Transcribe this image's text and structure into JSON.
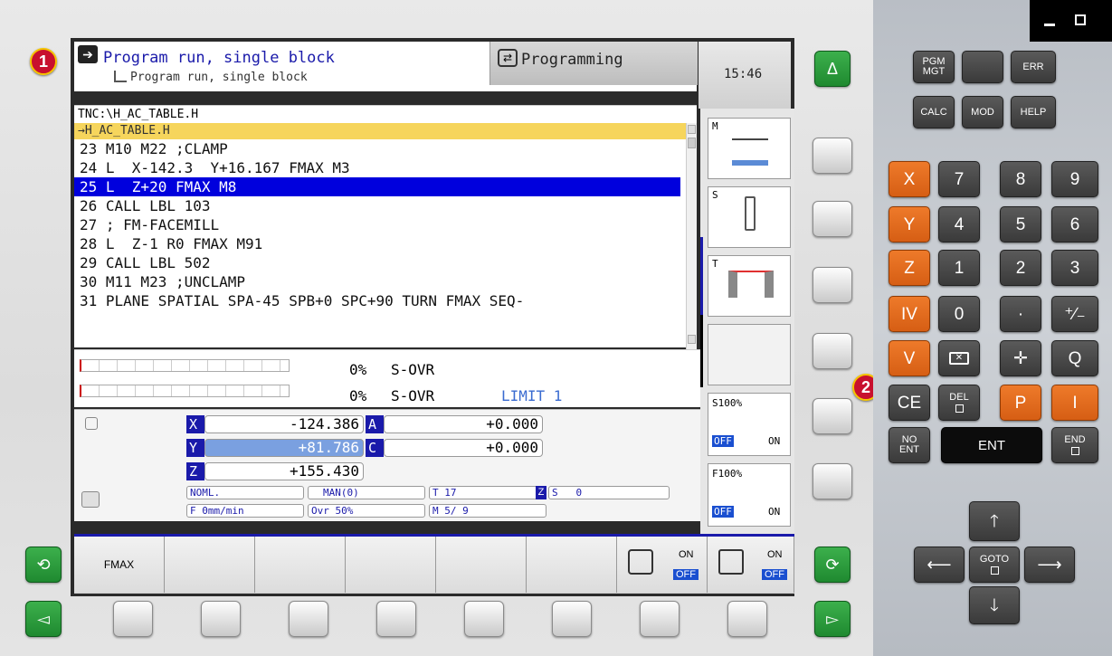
{
  "screen": {
    "mode_active": "Program run, single block",
    "mode_sub": "Program run, single block",
    "mode_other": "Programming",
    "clock": "15:46",
    "path": "TNC:\\H_AC_TABLE.H",
    "file_label": "→H_AC_TABLE.H",
    "program_lines": [
      "23 M10 M22 ;CLAMP",
      "24 L  X-142.3  Y+16.167 FMAX M3",
      "25 L  Z+20 FMAX M8",
      "26 CALL LBL 103",
      "27 ; FM-FACEMILL",
      "28 L  Z-1 R0 FMAX M91",
      "29 CALL LBL 502",
      "30 M11 M23 ;UNCLAMP",
      "31 PLANE SPATIAL SPA-45 SPB+0 SPC+90 TURN FMAX SEQ-"
    ],
    "selected_line_index": 2,
    "override_rows": [
      {
        "pct": "0%",
        "label": "S-OVR",
        "extra": ""
      },
      {
        "pct": "0%",
        "label": "S-OVR",
        "extra": "LIMIT 1"
      }
    ],
    "positions": {
      "X": "-124.386",
      "Y": "+81.786",
      "Z": "+155.430",
      "A": "+0.000",
      "C": "+0.000"
    },
    "status": {
      "noml": "NOML.",
      "man": "MAN(0)",
      "tool": "T 17",
      "z": "Z",
      "s": "S",
      "s_val": "0",
      "feed": "F 0mm/min",
      "ovr": "Ovr  50%",
      "m": "M 5/ 9"
    },
    "vert_keys": {
      "m": "M",
      "s": "S",
      "t": "T",
      "s100": "S100%",
      "f100": "F100%",
      "off": "OFF",
      "on": "ON"
    },
    "softkeys": {
      "fmax": "FMAX",
      "on": "ON",
      "off": "OFF"
    }
  },
  "badges": [
    "1",
    "2"
  ],
  "keyboard": {
    "pgm_mgt": "PGM\nMGT",
    "err": "ERR",
    "calc": "CALC",
    "mod": "MOD",
    "help": "HELP",
    "axes": [
      "X",
      "Y",
      "Z",
      "IV",
      "V"
    ],
    "digits": [
      "7",
      "8",
      "9",
      "4",
      "5",
      "6",
      "1",
      "2",
      "3",
      "0",
      "·",
      "⁺∕₋"
    ],
    "q": "Q",
    "ce": "CE",
    "del": "DEL",
    "p": "P",
    "i": "I",
    "no_ent": "NO\nENT",
    "ent": "ENT",
    "end": "END",
    "goto": "GOTO"
  },
  "colors": {
    "accent_blue": "#1a1aaa",
    "select_blue": "#0000dd",
    "green": "#2a9d3a",
    "orange": "#e86b1f",
    "badge_red": "#c8102e"
  }
}
